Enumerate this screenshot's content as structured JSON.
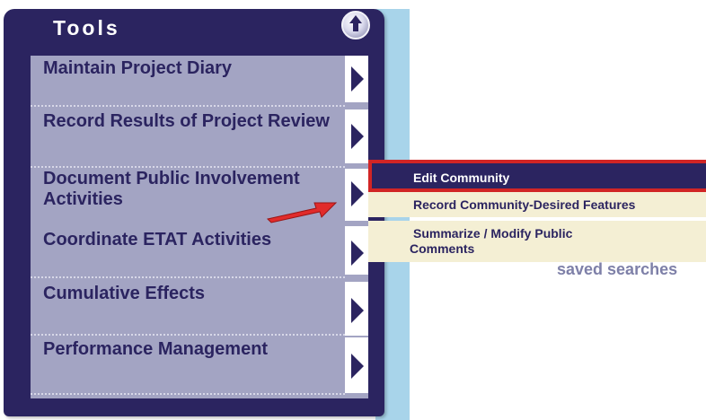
{
  "tools_panel": {
    "title": "Tools",
    "items": [
      {
        "label": "Maintain Project Diary"
      },
      {
        "label": "Record Results of Project Review"
      },
      {
        "label": "Document Public Involvement Activities"
      },
      {
        "label": "Coordinate ETAT Activities"
      },
      {
        "label": "Cumulative Effects"
      },
      {
        "label": "Performance Management"
      }
    ]
  },
  "submenu": {
    "edit_community": "Edit Community",
    "record_features": "Record Community-Desired Features",
    "summarize_line1": "Summarize / Modify Public",
    "summarize_line2": "Comments"
  },
  "background_text": "saved searches",
  "colors": {
    "panel_navy": "#2b2460",
    "menu_lavender": "#a3a4c3",
    "highlight_red": "#d12525",
    "submenu_cream": "#f4efd4",
    "light_blue_strip": "#a8d4ea"
  }
}
